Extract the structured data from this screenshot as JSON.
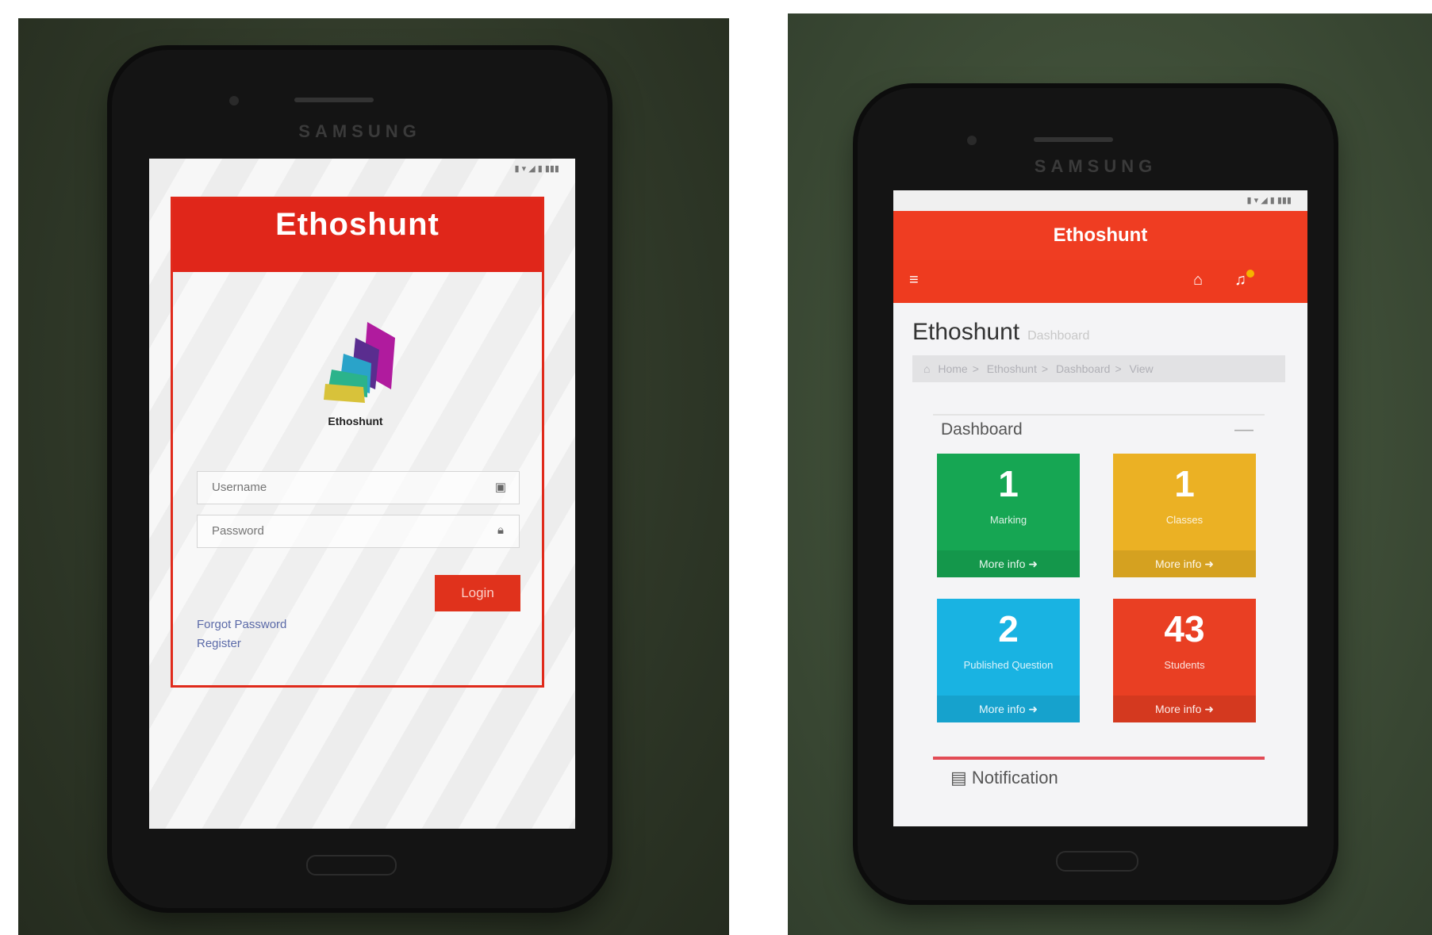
{
  "left_phone": {
    "brand": "SAMSUNG",
    "status_text": "",
    "login": {
      "title": "Ethoshunt",
      "logo_caption": "Ethoshunt",
      "username_placeholder": "Username",
      "password_placeholder": "Password",
      "login_label": "Login",
      "forgot_label": "Forgot Password",
      "register_label": "Register"
    }
  },
  "right_phone": {
    "brand": "SAMSUNG",
    "app_title": "Ethoshunt",
    "page_title": "Ethoshunt",
    "page_subtitle": "Dashboard",
    "breadcrumb": [
      "Home",
      "Ethoshunt",
      "Dashboard",
      "View"
    ],
    "panel_title": "Dashboard",
    "panel_collapse": "—",
    "tiles": [
      {
        "value": "1",
        "label": "Marking",
        "more": "More info"
      },
      {
        "value": "1",
        "label": "Classes",
        "more": "More info"
      },
      {
        "value": "2",
        "label": "Published Question",
        "more": "More info"
      },
      {
        "value": "43",
        "label": "Students",
        "more": "More info"
      }
    ],
    "notification_label": "Notification"
  },
  "colors": {
    "brand_red": "#e0261a",
    "tile_green": "#16a653",
    "tile_yellow": "#ebb124",
    "tile_blue": "#19b3e2",
    "tile_red": "#e93f23"
  }
}
